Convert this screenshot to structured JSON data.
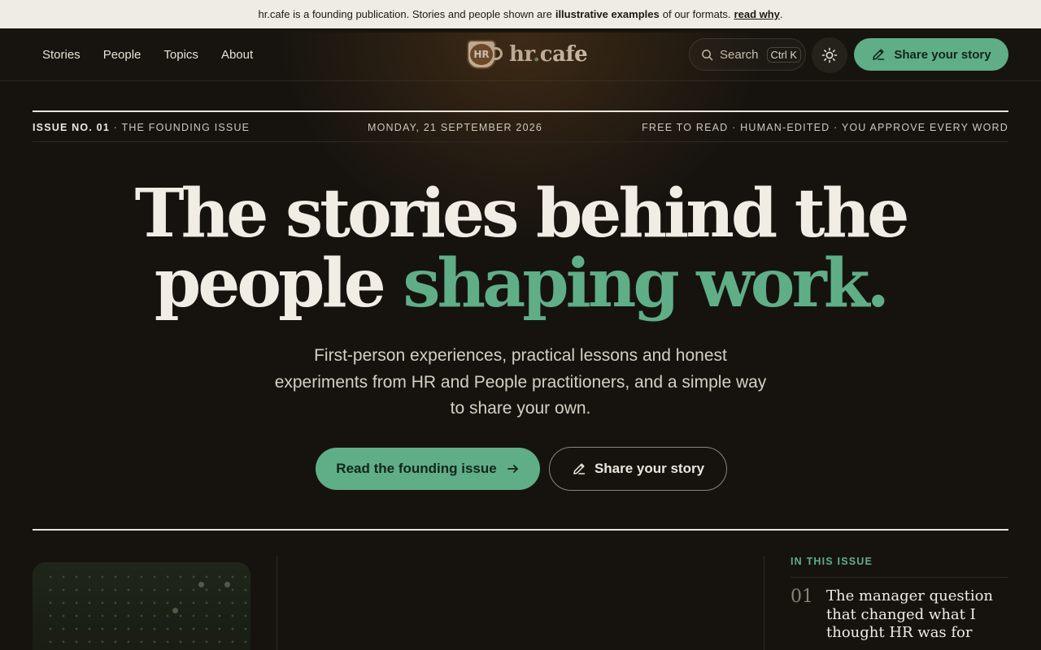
{
  "announcement": {
    "pre": "hr.cafe is a founding publication. Stories and people shown are",
    "bold": "illustrative examples",
    "post": "of our formats.",
    "link": "read why",
    "end": "."
  },
  "nav": {
    "items": [
      "Stories",
      "People",
      "Topics",
      "About"
    ],
    "logo_mark": "HR",
    "logo_name": "hr",
    "logo_dot": ".",
    "logo_suffix": "cafe",
    "search_label": "Search",
    "search_shortcut": "Ctrl K",
    "share_label": "Share your story"
  },
  "masthead": {
    "issue": "ISSUE NO. 01",
    "issue_sub": " · THE FOUNDING ISSUE",
    "date": "MONDAY, 21 SEPTEMBER 2026",
    "tagline": "FREE TO READ · HUMAN-EDITED · YOU APPROVE EVERY WORD"
  },
  "hero": {
    "line1": "The stories behind the",
    "line2_plain": "people ",
    "line2_accent": "shaping work.",
    "subtitle": "First-person experiences, practical lessons and honest experiments from HR and People practitioners, and a simple way to share your own.",
    "cta_primary": "Read the founding issue",
    "cta_secondary": "Share your story"
  },
  "in_this_issue": {
    "label": "IN THIS ISSUE",
    "items": [
      {
        "num": "01",
        "title": "The manager question that changed what I thought HR was for"
      }
    ]
  },
  "colors": {
    "accent": "#5fae87",
    "background": "#16130f",
    "announcement_bg": "#efebe5"
  }
}
